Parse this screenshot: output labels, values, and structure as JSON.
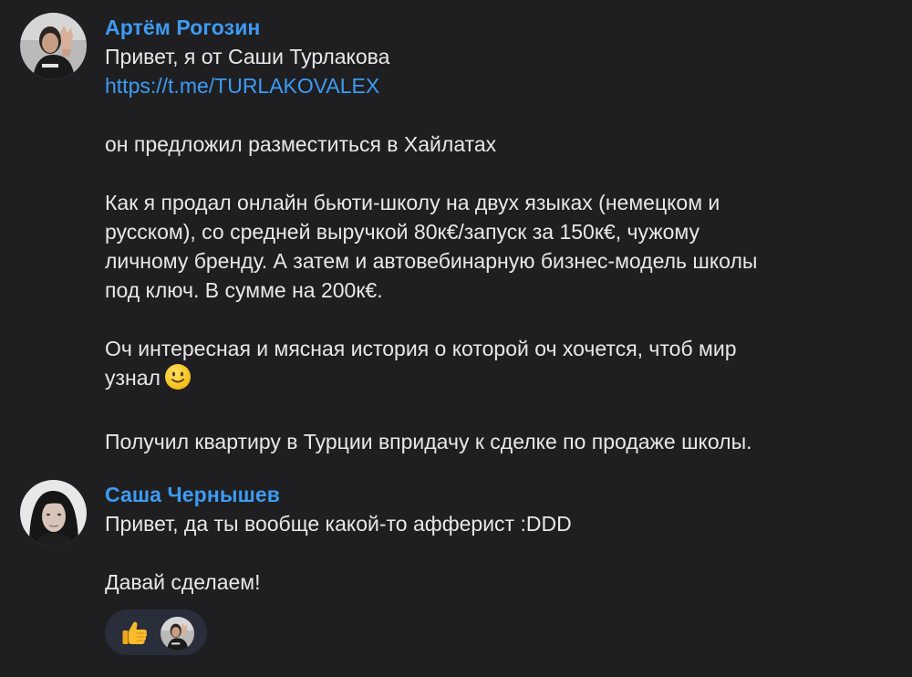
{
  "messages": [
    {
      "author": "Артём Рогозин",
      "lines": [
        "Привет, я от Саши Турлакова"
      ],
      "link": "https://t.me/TURLAKOVALEX",
      "paragraph_2": "он предложил разместиться в Хайлатах",
      "paragraph_3": [
        "Как я продал онлайн бьюти-школу на двух языках (немецком и",
        "русском), со средней выручкой 80к€/запуск за 150к€, чужому",
        "личному бренду. А затем и автовебинарную бизнес-модель школы",
        "под ключ. В сумме на 200к€."
      ],
      "paragraph_4": [
        "Оч интересная и мясная история о которой оч хочется, чтоб мир",
        "узнал"
      ],
      "paragraph_5": "Получил квартиру в Турции впридачу к сделке по продаже школы.",
      "emoji": "slightly-smiling-face-icon"
    },
    {
      "author": "Саша Чернышев",
      "line_1": "Привет, да ты вообще какой-то афферист :DDD",
      "line_2": "Давай сделаем!",
      "reaction": {
        "emoji": "thumbs-up-icon"
      }
    }
  ],
  "colors": {
    "background": "#1f1f21",
    "author_name": "#3d9bf5",
    "link": "#3d9bf5",
    "text": "#e8e8ea",
    "reaction_bg": "#2a2d3a"
  }
}
